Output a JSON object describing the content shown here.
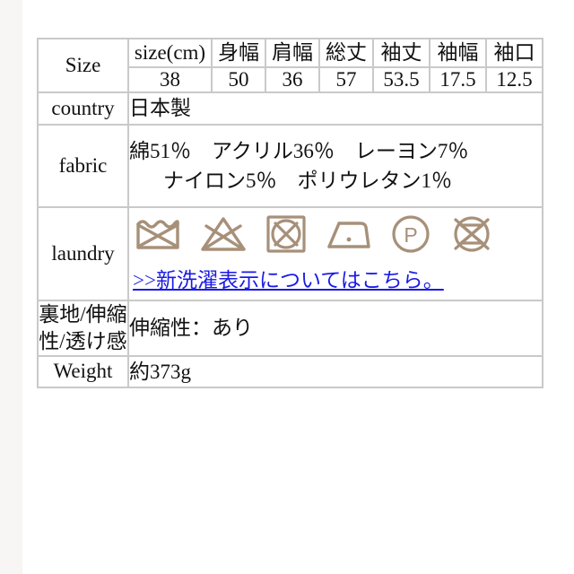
{
  "table": {
    "size_row": {
      "label": "Size",
      "headers": [
        "size(cm)",
        "身幅",
        "肩幅",
        "総丈",
        "袖丈",
        "袖幅",
        "袖口"
      ],
      "values": [
        "38",
        "50",
        "36",
        "57",
        "53.5",
        "17.5",
        "12.5"
      ]
    },
    "rows": [
      {
        "label": "country",
        "value": "日本製"
      },
      {
        "label": "fabric",
        "value_line1": "綿51％　アクリル36％　レーヨン7％",
        "value_line2": "ナイロン5％　ポリウレタン1％"
      },
      {
        "label": "laundry",
        "link_text": ">>新洗濯表示についてはこちら。",
        "symbols": [
          "do-not-wash-icon",
          "do-not-bleach-icon",
          "do-not-tumble-dry-icon",
          "iron-low-heat-icon",
          "dryclean-petroleum-icon",
          "do-not-wring-icon"
        ]
      },
      {
        "label": "裏地/伸縮性/透け感",
        "value": "伸縮性：あり"
      },
      {
        "label": "Weight",
        "value": "約373g"
      }
    ]
  },
  "colors": {
    "border": "#c9c9c9",
    "text": "#111111",
    "link": "#1a1ae6",
    "laundry_symbol": "#a79079",
    "background": "#ffffff"
  }
}
